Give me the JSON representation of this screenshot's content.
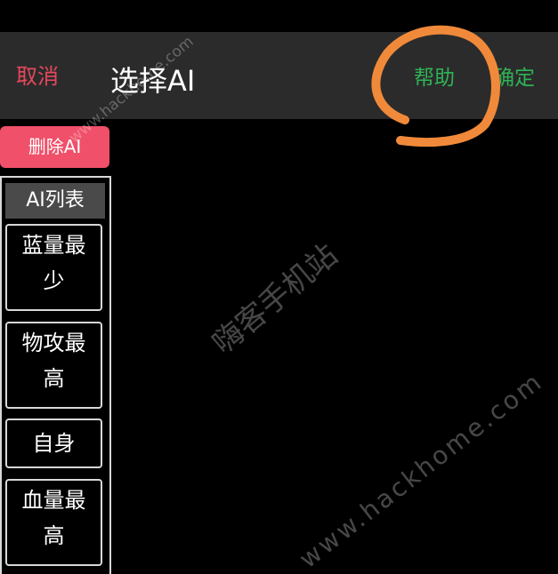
{
  "header": {
    "cancel_label": "取消",
    "title": "选择AI",
    "help_label": "帮助",
    "confirm_label": "确定"
  },
  "sidebar": {
    "delete_label": "删除AI",
    "list_header": "AI列表",
    "items": [
      {
        "label": "蓝量最少"
      },
      {
        "label": "物攻最高"
      },
      {
        "label": "自身"
      },
      {
        "label": "血量最高"
      }
    ]
  },
  "watermark": {
    "site_a": "www.hackhome.com",
    "site_b": "嗨客手机站",
    "site_c": "www.hackhome.com"
  },
  "colors": {
    "cancel": "#e5485c",
    "help": "#2fb356",
    "confirm": "#2fb356",
    "delete_button": "#f0506a",
    "annotation_circle": "#f08a3a",
    "topbar": "#2b2b2b"
  }
}
